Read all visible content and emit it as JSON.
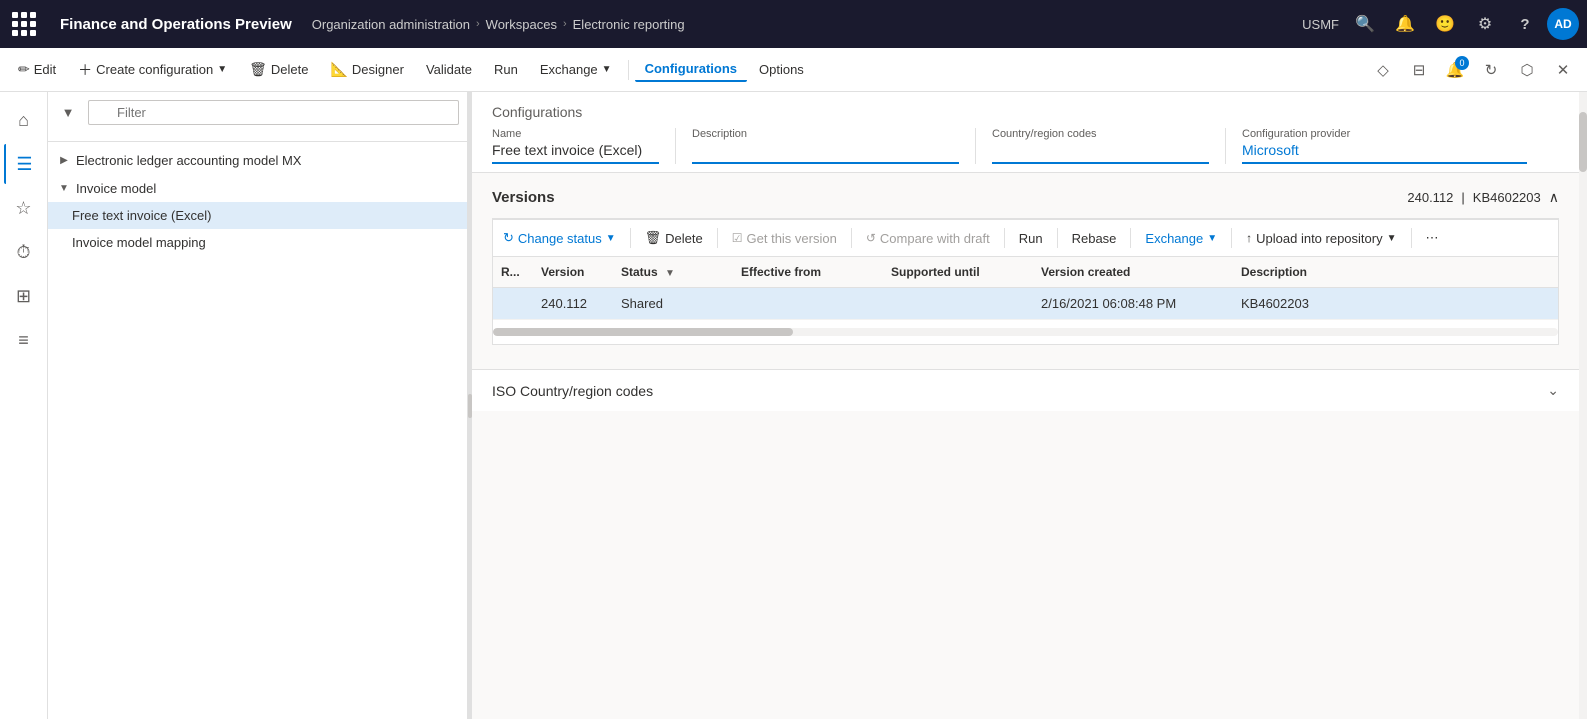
{
  "topbar": {
    "app_title": "Finance and Operations Preview",
    "breadcrumb": [
      {
        "label": "Organization administration"
      },
      {
        "label": "Workspaces"
      },
      {
        "label": "Electronic reporting"
      }
    ],
    "org": "USMF",
    "avatar_initials": "AD"
  },
  "commandbar": {
    "edit_label": "Edit",
    "create_config_label": "Create configuration",
    "delete_label": "Delete",
    "designer_label": "Designer",
    "validate_label": "Validate",
    "run_label": "Run",
    "exchange_label": "Exchange",
    "configurations_label": "Configurations",
    "options_label": "Options"
  },
  "tree": {
    "filter_placeholder": "Filter",
    "items": [
      {
        "label": "Electronic ledger accounting model MX",
        "level": 0,
        "expanded": false
      },
      {
        "label": "Invoice model",
        "level": 0,
        "expanded": true
      },
      {
        "label": "Free text invoice (Excel)",
        "level": 1,
        "selected": true
      },
      {
        "label": "Invoice model mapping",
        "level": 1,
        "selected": false
      }
    ]
  },
  "configurations": {
    "section_title": "Configurations",
    "fields": {
      "name_label": "Name",
      "name_value": "Free text invoice (Excel)",
      "description_label": "Description",
      "description_value": "",
      "country_codes_label": "Country/region codes",
      "country_codes_value": "",
      "config_provider_label": "Configuration provider",
      "config_provider_value": "Microsoft"
    }
  },
  "versions": {
    "section_title": "Versions",
    "version_number": "240.112",
    "kb_number": "KB4602203",
    "toolbar": {
      "change_status_label": "Change status",
      "delete_label": "Delete",
      "get_this_version_label": "Get this version",
      "compare_with_draft_label": "Compare with draft",
      "run_label": "Run",
      "rebase_label": "Rebase",
      "exchange_label": "Exchange",
      "upload_into_repository_label": "Upload into repository",
      "more_label": "..."
    },
    "table": {
      "columns": [
        {
          "key": "r",
          "label": "R..."
        },
        {
          "key": "version",
          "label": "Version"
        },
        {
          "key": "status",
          "label": "Status"
        },
        {
          "key": "effective_from",
          "label": "Effective from"
        },
        {
          "key": "supported_until",
          "label": "Supported until"
        },
        {
          "key": "version_created",
          "label": "Version created"
        },
        {
          "key": "description",
          "label": "Description"
        }
      ],
      "rows": [
        {
          "r": "",
          "version": "240.112",
          "status": "Shared",
          "effective_from": "",
          "supported_until": "",
          "version_created": "2/16/2021 06:08:48 PM",
          "description": "KB4602203",
          "selected": true
        }
      ]
    }
  },
  "iso_section": {
    "title": "ISO Country/region codes"
  },
  "icons": {
    "waffle": "⊞",
    "search": "🔍",
    "bell": "🔔",
    "smiley": "🙂",
    "gear": "⚙",
    "help": "?",
    "home": "⌂",
    "star": "☆",
    "history": "⏱",
    "list": "☰",
    "filter": "▼",
    "expand": "▶",
    "collapse": "▼",
    "chevron_right": "›",
    "chevron_down": "⌄",
    "edit": "✏",
    "delete_icon": "🗑",
    "designer_icon": "📐",
    "refresh": "↻",
    "upload": "↑",
    "down_arrow": "⌄",
    "collapse_up": "∧",
    "more": "⋯"
  }
}
